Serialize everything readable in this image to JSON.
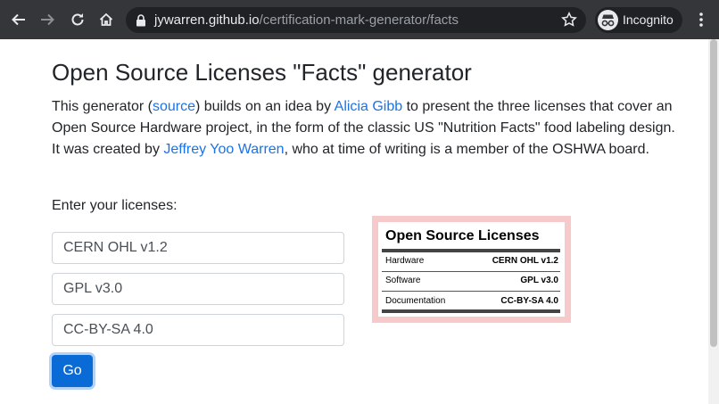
{
  "browser": {
    "url_host": "jywarren.github.io",
    "url_path": "/certification-mark-generator/facts",
    "profile_label": "Incognito"
  },
  "page": {
    "title": "Open Source Licenses \"Facts\" generator",
    "intro": {
      "t1": "This generator (",
      "link_source": "source",
      "t2": ") builds on an idea by ",
      "link_author": "Alicia Gibb",
      "t3": " to present the three licenses that cover an Open Source Hardware project, in the form of the classic US \"Nutrition Facts\" food labeling design. It was created by ",
      "link_creator": "Jeffrey Yoo Warren",
      "t4": ", who at time of writing is a member of the OSHWA board."
    },
    "form_label": "Enter your licenses:",
    "inputs": {
      "hardware": "CERN OHL v1.2",
      "software": "GPL v3.0",
      "documentation": "CC-BY-SA 4.0"
    },
    "go_label": "Go"
  },
  "facts": {
    "title": "Open Source Licenses",
    "rows": [
      {
        "label": "Hardware",
        "value": "CERN OHL v1.2"
      },
      {
        "label": "Software",
        "value": "GPL v3.0"
      },
      {
        "label": "Documentation",
        "value": "CC-BY-SA 4.0"
      }
    ]
  },
  "colors": {
    "link": "#1a73e8",
    "button": "#0b6bd6",
    "label_frame": "#f6caca",
    "chrome": "#35363a"
  },
  "icons": [
    "back-arrow-icon",
    "forward-arrow-icon",
    "reload-icon",
    "home-icon",
    "lock-icon",
    "star-icon",
    "incognito-icon",
    "kebab-menu-icon"
  ]
}
